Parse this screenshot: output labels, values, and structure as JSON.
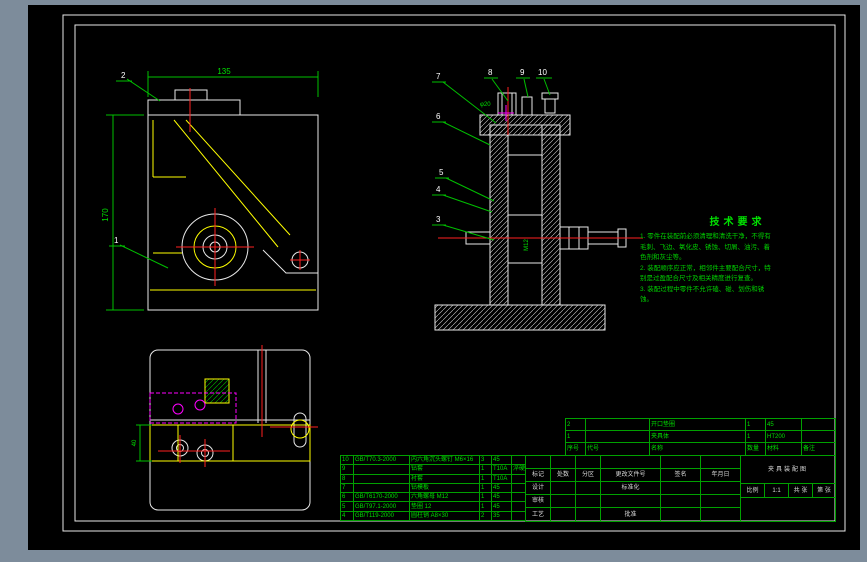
{
  "window": {
    "bg": "#7d8c9b",
    "canvas_bg": "#000000",
    "line_white": "#e8e8e8",
    "line_green": "#00c000",
    "line_red": "#ff2020",
    "line_yellow": "#ffff00",
    "line_magenta": "#ff00ff"
  },
  "dims": {
    "front_width": "135",
    "front_height": "170",
    "section_dia": "φ20",
    "section_thread": "M12",
    "plan_depth": "40"
  },
  "balloons": [
    "1",
    "2",
    "3",
    "4",
    "5",
    "6",
    "7",
    "8",
    "9",
    "10"
  ],
  "tech": {
    "title": "技术要求",
    "lines": [
      "1. 零件在装配前必须清理和清洗干净，不得有",
      "毛刺、飞边、氧化皮、锈蚀、切屑、油污、着",
      "色剂和灰尘等。",
      "2. 装配顺序应正常，相邻件主要配合尺寸，特",
      "别是过盈配合尺寸及相关精度进行复查。",
      "3. 装配过程中零件不允许磕、碰、划伤和锈",
      "蚀。"
    ]
  },
  "upper_table": {
    "header": [
      "序号",
      "代号",
      "名称",
      "数量",
      "材料",
      "备注"
    ],
    "rows": [
      [
        "2",
        "",
        "开口垫圈",
        "1",
        "45",
        ""
      ],
      [
        "1",
        "",
        "夹具体",
        "1",
        "HT200",
        ""
      ]
    ]
  },
  "parts_table": {
    "rows": [
      [
        "10",
        "GB/T70.3-2000",
        "内六角沉头螺钉 M6×16",
        "3",
        "45",
        ""
      ],
      [
        "9",
        "",
        "钻套",
        "1",
        "T10A",
        "淬硬"
      ],
      [
        "8",
        "",
        "衬套",
        "1",
        "T10A",
        ""
      ],
      [
        "7",
        "",
        "钻模板",
        "1",
        "45",
        ""
      ],
      [
        "6",
        "GB/T6170-2000",
        "六角螺母 M12",
        "1",
        "45",
        ""
      ],
      [
        "5",
        "GB/T97.1-2000",
        "垫圈 12",
        "1",
        "45",
        ""
      ],
      [
        "4",
        "GB/T119-2000",
        "圆柱销 A8×30",
        "2",
        "35",
        ""
      ]
    ]
  },
  "title_block": {
    "rev_header": [
      "标记",
      "处数",
      "分区",
      "更改文件号",
      "签名",
      "年月日"
    ],
    "design": "设计",
    "check": "审核",
    "process": "工艺",
    "standard": "标准化",
    "approve": "批准",
    "name": "夹具装配图",
    "scale_label": "比例",
    "scale": "1:1",
    "sheets": "共 张",
    "sheet_no": "第 张"
  }
}
